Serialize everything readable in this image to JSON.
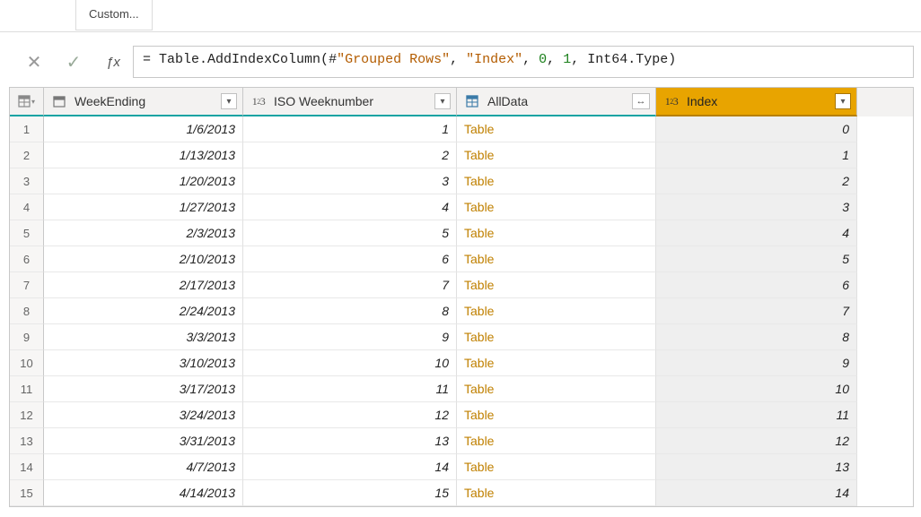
{
  "ribbon": {
    "custom_label": "Custom..."
  },
  "formula": {
    "eq": "= ",
    "fn": "Table.AddIndexColumn",
    "open": "(",
    "ref_hash": "#",
    "ref": "\"Grouped Rows\"",
    "sep1": ", ",
    "colname": "\"Index\"",
    "sep2": ", ",
    "start": "0",
    "sep3": ", ",
    "step": "1",
    "sep4": ", ",
    "type": "Int64.Type",
    "close": ")"
  },
  "columns": {
    "weekending": "WeekEnding",
    "iso": "ISO Weeknumber",
    "alldata": "AllData",
    "index": "Index"
  },
  "rows": [
    {
      "n": "1",
      "weekending": "1/6/2013",
      "iso": "1",
      "alldata": "Table",
      "index": "0"
    },
    {
      "n": "2",
      "weekending": "1/13/2013",
      "iso": "2",
      "alldata": "Table",
      "index": "1"
    },
    {
      "n": "3",
      "weekending": "1/20/2013",
      "iso": "3",
      "alldata": "Table",
      "index": "2"
    },
    {
      "n": "4",
      "weekending": "1/27/2013",
      "iso": "4",
      "alldata": "Table",
      "index": "3"
    },
    {
      "n": "5",
      "weekending": "2/3/2013",
      "iso": "5",
      "alldata": "Table",
      "index": "4"
    },
    {
      "n": "6",
      "weekending": "2/10/2013",
      "iso": "6",
      "alldata": "Table",
      "index": "5"
    },
    {
      "n": "7",
      "weekending": "2/17/2013",
      "iso": "7",
      "alldata": "Table",
      "index": "6"
    },
    {
      "n": "8",
      "weekending": "2/24/2013",
      "iso": "8",
      "alldata": "Table",
      "index": "7"
    },
    {
      "n": "9",
      "weekending": "3/3/2013",
      "iso": "9",
      "alldata": "Table",
      "index": "8"
    },
    {
      "n": "10",
      "weekending": "3/10/2013",
      "iso": "10",
      "alldata": "Table",
      "index": "9"
    },
    {
      "n": "11",
      "weekending": "3/17/2013",
      "iso": "11",
      "alldata": "Table",
      "index": "10"
    },
    {
      "n": "12",
      "weekending": "3/24/2013",
      "iso": "12",
      "alldata": "Table",
      "index": "11"
    },
    {
      "n": "13",
      "weekending": "3/31/2013",
      "iso": "13",
      "alldata": "Table",
      "index": "12"
    },
    {
      "n": "14",
      "weekending": "4/7/2013",
      "iso": "14",
      "alldata": "Table",
      "index": "13"
    },
    {
      "n": "15",
      "weekending": "4/14/2013",
      "iso": "15",
      "alldata": "Table",
      "index": "14"
    }
  ]
}
